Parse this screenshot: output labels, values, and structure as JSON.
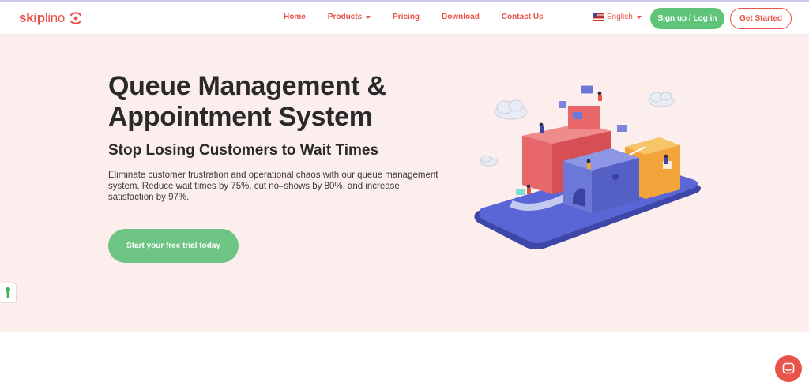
{
  "brand": {
    "name_bold": "skip",
    "name_light": "lino",
    "accent": "#e8534a",
    "green": "#5fc47a",
    "hero_bg": "#fdeeee"
  },
  "nav": {
    "home": "Home",
    "products": "Products",
    "pricing": "Pricing",
    "download": "Download",
    "contact": "Contact Us"
  },
  "language": {
    "label": "English",
    "flag_icon": "us-flag-icon"
  },
  "header_buttons": {
    "signup": "Sign up / Log in",
    "get_started": "Get Started"
  },
  "hero": {
    "title_line1": "Queue Management &",
    "title_line2": "Appointment System",
    "subtitle": "Stop Losing Customers to Wait Times",
    "description": "Eliminate customer frustration and operational chaos with our queue management system. Reduce wait times by 75%, cut no–shows by 80%, and increase satisfaction by 97%.",
    "cta": "Start your free trial today"
  },
  "widgets": {
    "accessibility_icon": "accessibility-icon",
    "chat_icon": "chat-icon"
  }
}
